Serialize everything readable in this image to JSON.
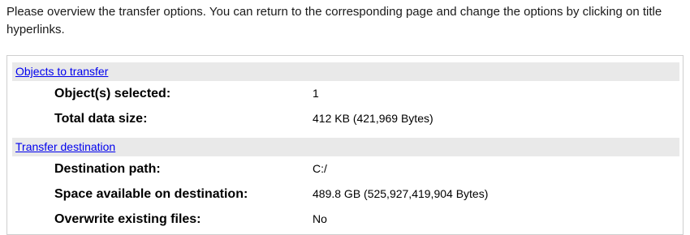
{
  "intro_text": "Please overview the transfer options. You can return to the corresponding page and change the options by clicking on title hyperlinks.",
  "sections": [
    {
      "title": "Objects to transfer",
      "rows": [
        {
          "label": "Object(s) selected:",
          "value": "1"
        },
        {
          "label": "Total data size:",
          "value": "412 KB (421,969 Bytes)"
        }
      ]
    },
    {
      "title": "Transfer destination",
      "rows": [
        {
          "label": "Destination path:",
          "value": "C:/"
        },
        {
          "label": "Space available on destination:",
          "value": "489.8 GB (525,927,419,904 Bytes)"
        },
        {
          "label": "Overwrite existing files:",
          "value": "No"
        }
      ]
    }
  ],
  "colors": {
    "link": "#0000ee",
    "section_header_bg": "#e9e9e9",
    "box_border": "#cfcfcf"
  }
}
